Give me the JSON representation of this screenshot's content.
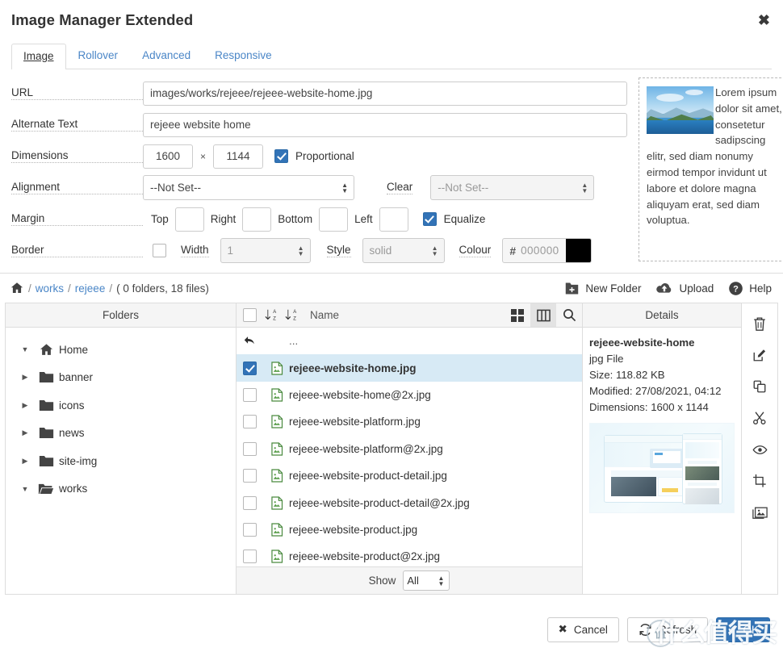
{
  "window": {
    "title": "Image Manager Extended",
    "close_label": "✖"
  },
  "tabs": [
    {
      "label": "Image",
      "active": true
    },
    {
      "label": "Rollover",
      "active": false
    },
    {
      "label": "Advanced",
      "active": false
    },
    {
      "label": "Responsive",
      "active": false
    }
  ],
  "form": {
    "url": {
      "label": "URL",
      "value": "images/works/rejeee/rejeee-website-home.jpg"
    },
    "alt": {
      "label": "Alternate Text",
      "value": "rejeee website home"
    },
    "dimensions": {
      "label": "Dimensions",
      "width": "1600",
      "separator": "×",
      "height": "1144",
      "proportional_label": "Proportional",
      "proportional_checked": true
    },
    "alignment": {
      "label": "Alignment",
      "value": "--Not Set--"
    },
    "clear": {
      "label": "Clear",
      "value": "--Not Set--",
      "disabled": true
    },
    "margin": {
      "label": "Margin",
      "top_label": "Top",
      "top_value": "",
      "right_label": "Right",
      "right_value": "",
      "bottom_label": "Bottom",
      "bottom_value": "",
      "left_label": "Left",
      "left_value": "",
      "equalize_label": "Equalize",
      "equalize_checked": true
    },
    "border": {
      "label": "Border",
      "enabled": false,
      "width_label": "Width",
      "width_value": "1",
      "style_label": "Style",
      "style_value": "solid",
      "colour_label": "Colour",
      "colour_hash": "#",
      "colour_value": "000000",
      "colour_swatch": "#000000"
    }
  },
  "preview": {
    "text": "Lorem ipsum dolor sit amet, consetetur sadipscing elitr, sed diam nonumy eirmod tempor invidunt ut labore et dolore magna aliquyam erat, sed diam voluptua."
  },
  "file_manager": {
    "breadcrumb": {
      "home_icon": "home-icon",
      "parts": [
        "works",
        "rejeee"
      ],
      "count": "( 0 folders, 18 files)"
    },
    "actions": [
      {
        "label": "New Folder",
        "icon": "new-folder-icon"
      },
      {
        "label": "Upload",
        "icon": "upload-icon"
      },
      {
        "label": "Help",
        "icon": "help-icon"
      }
    ],
    "folders_header": "Folders",
    "folders": [
      {
        "label": "Home",
        "icon": "home-icon",
        "expanded": true,
        "depth": 0
      },
      {
        "label": "banner",
        "icon": "folder-icon",
        "expanded": false,
        "depth": 0
      },
      {
        "label": "icons",
        "icon": "folder-icon",
        "expanded": false,
        "depth": 0
      },
      {
        "label": "news",
        "icon": "folder-icon",
        "expanded": false,
        "depth": 0
      },
      {
        "label": "site-img",
        "icon": "folder-icon",
        "expanded": false,
        "depth": 0
      },
      {
        "label": "works",
        "icon": "folder-open-icon",
        "expanded": true,
        "depth": 0
      }
    ],
    "files_header": {
      "name_column": "Name",
      "sort_asc_icon": "sort-alpha-asc-icon",
      "sort_desc_icon": "sort-alpha-desc-icon",
      "grid_view_icon": "grid-view-icon",
      "split_view_icon": "split-view-icon",
      "search_icon": "search-icon",
      "active_view": "split"
    },
    "up_row": {
      "label": "...",
      "icon": "arrow-back-icon"
    },
    "files": [
      {
        "name": "rejeee-website-home.jpg",
        "selected": true
      },
      {
        "name": "rejeee-website-home@2x.jpg",
        "selected": false
      },
      {
        "name": "rejeee-website-platform.jpg",
        "selected": false
      },
      {
        "name": "rejeee-website-platform@2x.jpg",
        "selected": false
      },
      {
        "name": "rejeee-website-product-detail.jpg",
        "selected": false
      },
      {
        "name": "rejeee-website-product-detail@2x.jpg",
        "selected": false
      },
      {
        "name": "rejeee-website-product.jpg",
        "selected": false
      },
      {
        "name": "rejeee-website-product@2x.jpg",
        "selected": false
      }
    ],
    "show": {
      "label": "Show",
      "value": "All"
    },
    "details_header": "Details",
    "details": {
      "name": "rejeee-website-home",
      "type": "jpg File",
      "size": "Size: 118.82 KB",
      "modified": "Modified: 27/08/2021, 04:12",
      "dimensions": "Dimensions: 1600 x 1144"
    },
    "details_tools": [
      {
        "icon": "trash-icon",
        "name": "delete"
      },
      {
        "icon": "edit-icon",
        "name": "rename"
      },
      {
        "icon": "copy-icon",
        "name": "copy"
      },
      {
        "icon": "scissors-icon",
        "name": "cut"
      },
      {
        "icon": "eye-icon",
        "name": "preview"
      },
      {
        "icon": "crop-icon",
        "name": "crop"
      },
      {
        "icon": "image-icon",
        "name": "resize"
      }
    ]
  },
  "footer": {
    "cancel_label": "Cancel",
    "refresh_label": "Refresh",
    "ok_label": "OK"
  },
  "watermark": {
    "text": "什么值得买",
    "logo": "值"
  },
  "colors": {
    "accent": "#3273b7",
    "link": "#4a86c7",
    "selected_row": "#d7eaf5",
    "border": "#dddddd"
  }
}
